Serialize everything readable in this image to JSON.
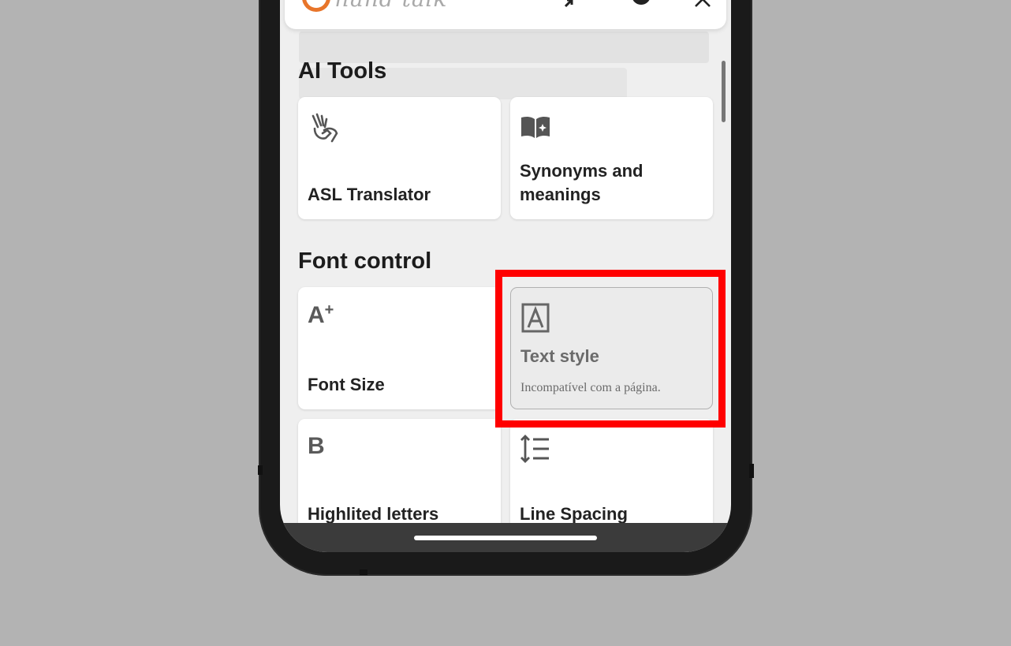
{
  "header": {
    "logo_text": "hand talk",
    "icons": [
      "collapse-icon",
      "gear-icon",
      "close-icon"
    ]
  },
  "sections": {
    "ai_tools": {
      "title": "AI Tools",
      "cards": [
        {
          "label": "ASL Translator",
          "icon": "sign-language-hands-icon"
        },
        {
          "label": "Synonyms and meanings",
          "icon": "book-sparkle-icon"
        }
      ]
    },
    "font_control": {
      "title": "Font control",
      "cards": [
        {
          "label": "Font Size",
          "icon_text": "A",
          "icon_sup": "+"
        },
        {
          "label": "Text style",
          "icon": "letter-a-box-icon",
          "status": "Incompatível com a página.",
          "disabled": true
        },
        {
          "label": "Highlited letters",
          "icon_text": "B"
        },
        {
          "label": "Line Spacing",
          "icon": "line-spacing-icon"
        }
      ]
    }
  },
  "colors": {
    "brand_orange": "#e8752a",
    "highlight_red": "#ff0000",
    "screen_bg": "#efefef"
  }
}
